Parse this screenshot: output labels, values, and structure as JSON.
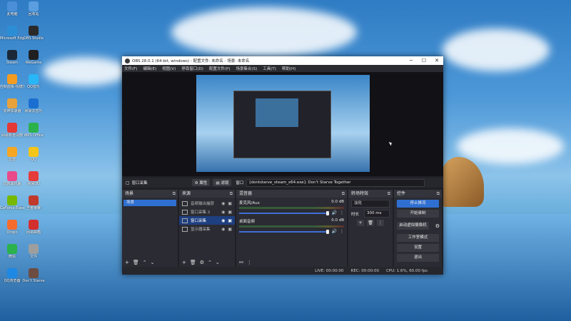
{
  "desktop_icons": [
    {
      "label": "此电脑",
      "color": "#4a8fd8"
    },
    {
      "label": "回收站",
      "color": "#5a9ee0"
    },
    {
      "label": "Microsoft Edge",
      "color": "#2c8fd6"
    },
    {
      "label": "OBS Studio",
      "color": "#2a2a2a"
    },
    {
      "label": "Steam",
      "color": "#1b2838"
    },
    {
      "label": "WeGame",
      "color": "#202020"
    },
    {
      "label": "控制面板-快捷方式",
      "color": "#f39c20"
    },
    {
      "label": "QQ音乐",
      "color": "#29b6f6"
    },
    {
      "label": "雷神加速器",
      "color": "#e8a23c"
    },
    {
      "label": "网易云音乐",
      "color": "#1a6fd0"
    },
    {
      "label": "网易有道词典",
      "color": "#e53935"
    },
    {
      "label": "WPS Office",
      "color": "#2bb24c"
    },
    {
      "label": "迅雷",
      "color": "#f5a623"
    },
    {
      "label": "QQ",
      "color": "#f5c518"
    },
    {
      "label": "饥荒联机版",
      "color": "#e84a8a"
    },
    {
      "label": "网易UU",
      "color": "#e53b3b"
    },
    {
      "label": "GeForce Experience",
      "color": "#76b900"
    },
    {
      "label": "王者荣耀",
      "color": "#c0392b"
    },
    {
      "label": "Origin",
      "color": "#f56c2d"
    },
    {
      "label": "网易邮箱",
      "color": "#d32f2f"
    },
    {
      "label": "微信",
      "color": "#2bb24c"
    },
    {
      "label": "文件",
      "color": "#9e9e9e"
    },
    {
      "label": "QQ浏览器",
      "color": "#1e88e5"
    },
    {
      "label": "Don't Starve",
      "color": "#6d4c41"
    }
  ],
  "window": {
    "title": "OBS 28.0.1 (64-bit, windows) - 配置文件: 未命名 - 场景: 未命名",
    "minimize": "─",
    "maximize": "☐",
    "close": "✕"
  },
  "menu": [
    "文件(F)",
    "编辑(E)",
    "视图(V)",
    "停靠窗口(D)",
    "配置文件(P)",
    "场景集合(S)",
    "工具(T)",
    "帮助(H)"
  ],
  "source_toolbar": {
    "source_name": "窗口采集",
    "properties": "属性",
    "filters": "滤镜",
    "window_label": "窗口",
    "window_value": "[dontstarve_steam_x64.exe]: Don't Starve Together"
  },
  "scenes": {
    "title": "场景",
    "items": [
      "场景"
    ]
  },
  "sources": {
    "title": "来源",
    "items": [
      {
        "name": "音频输出捕获",
        "selected": false
      },
      {
        "name": "窗口采集 2",
        "selected": false
      },
      {
        "name": "窗口采集",
        "selected": true
      },
      {
        "name": "显示器采集",
        "selected": false
      }
    ]
  },
  "mixer": {
    "title": "混音器",
    "channels": [
      {
        "name": "麦克风/Aux",
        "db": "0.0 dB"
      },
      {
        "name": "桌面音频",
        "db": "0.0 dB"
      }
    ]
  },
  "transitions": {
    "title": "转场特效",
    "type": "淡化",
    "duration_label": "时长",
    "duration_value": "300 ms"
  },
  "controls": {
    "title": "控件",
    "buttons": [
      "停止推流",
      "开始录制",
      "启动虚拟摄像机",
      "工作室模式",
      "设置",
      "退出"
    ]
  },
  "status": {
    "live": "LIVE: 00:00:00",
    "rec": "REC: 00:00:00",
    "cpu": "CPU: 1.6%, 60.00 fps"
  }
}
